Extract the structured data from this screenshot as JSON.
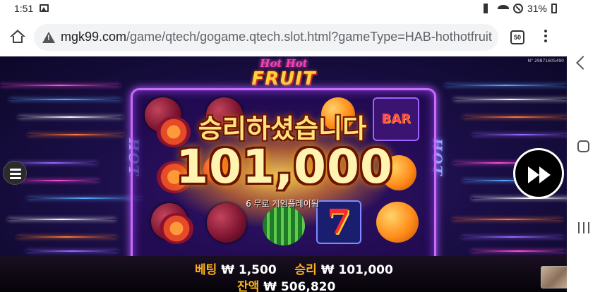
{
  "status_bar": {
    "time": "1:51",
    "battery": "31%"
  },
  "browser": {
    "url_host": "mgk99.com",
    "url_path": "/game/qtech/gogame.qtech.slot.html?gameType=HAB-hothotfruit",
    "tab_count": "50"
  },
  "game": {
    "logo_small": "Hot Hot",
    "logo_big": "FRUIT",
    "side_label_left": "HOT",
    "side_label_right": "HOT",
    "serial": "N° 29871605490",
    "win_title": "승리하셨습니다",
    "win_amount": "101,000",
    "free_spins_text": "6 무로 게임플레이됨",
    "bar_symbol": "BAR",
    "seven_symbol": "7",
    "bet_label": "베팅",
    "bet_value": "₩ 1,500",
    "win_label": "승리",
    "win_value": "₩ 101,000",
    "balance_label": "잔액",
    "balance_value": "₩ 506,820"
  },
  "icons": {
    "menu": "hamburger-menu-icon",
    "turbo": "fast-forward-icon",
    "home": "home-icon",
    "warning": "warning-icon"
  },
  "colors": {
    "frame_neon": "#c96bff",
    "win_gold": "#ffe27a",
    "stat_label": "#ffb21a"
  }
}
